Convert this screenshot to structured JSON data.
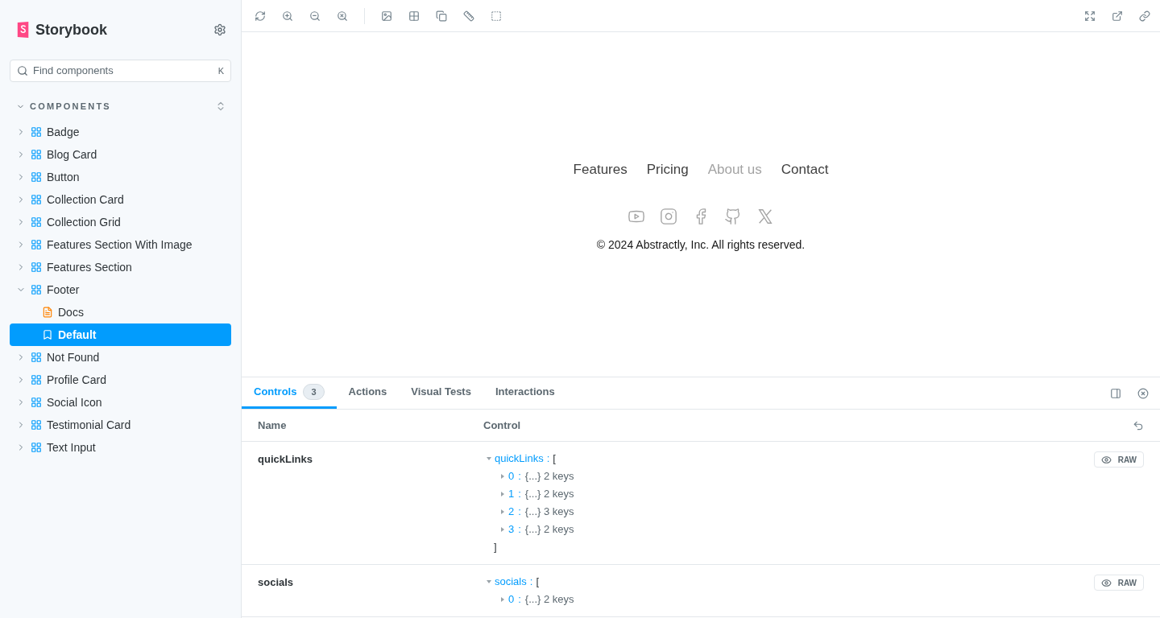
{
  "sidebar": {
    "brand": "Storybook",
    "search": {
      "placeholder": "Find components",
      "shortcut": "K"
    },
    "section": {
      "label": "COMPONENTS",
      "expanded": true
    },
    "items": [
      {
        "kind": "component",
        "label": "Badge",
        "expanded": false,
        "selected": false
      },
      {
        "kind": "component",
        "label": "Blog Card",
        "expanded": false,
        "selected": false
      },
      {
        "kind": "component",
        "label": "Button",
        "expanded": false,
        "selected": false
      },
      {
        "kind": "component",
        "label": "Collection Card",
        "expanded": false,
        "selected": false
      },
      {
        "kind": "component",
        "label": "Collection Grid",
        "expanded": false,
        "selected": false
      },
      {
        "kind": "component",
        "label": "Features Section With Image",
        "expanded": false,
        "selected": false
      },
      {
        "kind": "component",
        "label": "Features Section",
        "expanded": false,
        "selected": false
      },
      {
        "kind": "component",
        "label": "Footer",
        "expanded": true,
        "selected": false,
        "children": [
          {
            "kind": "docs",
            "label": "Docs",
            "selected": false
          },
          {
            "kind": "story",
            "label": "Default",
            "selected": true
          }
        ]
      },
      {
        "kind": "component",
        "label": "Not Found",
        "expanded": false,
        "selected": false
      },
      {
        "kind": "component",
        "label": "Profile Card",
        "expanded": false,
        "selected": false
      },
      {
        "kind": "component",
        "label": "Social Icon",
        "expanded": false,
        "selected": false
      },
      {
        "kind": "component",
        "label": "Testimonial Card",
        "expanded": false,
        "selected": false
      },
      {
        "kind": "component",
        "label": "Text Input",
        "expanded": false,
        "selected": false
      }
    ]
  },
  "preview": {
    "links": [
      {
        "label": "Features",
        "selected": false
      },
      {
        "label": "Pricing",
        "selected": false
      },
      {
        "label": "About us",
        "selected": true
      },
      {
        "label": "Contact",
        "selected": false
      }
    ],
    "socials": [
      {
        "kind": "youtube"
      },
      {
        "kind": "instagram"
      },
      {
        "kind": "facebook"
      },
      {
        "kind": "github"
      },
      {
        "kind": "x"
      }
    ],
    "copyright": "© 2024 Abstractly, Inc. All rights reserved."
  },
  "panel": {
    "tabs": [
      {
        "label": "Controls",
        "count": "3",
        "selected": true
      },
      {
        "label": "Actions",
        "selected": false
      },
      {
        "label": "Visual Tests",
        "selected": false
      },
      {
        "label": "Interactions",
        "selected": false
      }
    ],
    "columns": [
      "Name",
      "Control"
    ],
    "rows": [
      {
        "name": "quickLinks",
        "raw": "RAW",
        "tree": {
          "key": "quickLinks",
          "sep": ":",
          "open": "[",
          "close": "]",
          "items": [
            {
              "index": "0",
              "summary": "{...} 2 keys"
            },
            {
              "index": "1",
              "summary": "{...} 2 keys"
            },
            {
              "index": "2",
              "summary": "{...} 3 keys"
            },
            {
              "index": "3",
              "summary": "{...} 2 keys"
            }
          ]
        }
      },
      {
        "name": "socials",
        "raw": "RAW",
        "tree": {
          "key": "socials",
          "sep": ":",
          "open": "[",
          "items": [
            {
              "index": "0",
              "summary": "{...} 2 keys"
            }
          ]
        }
      }
    ]
  }
}
